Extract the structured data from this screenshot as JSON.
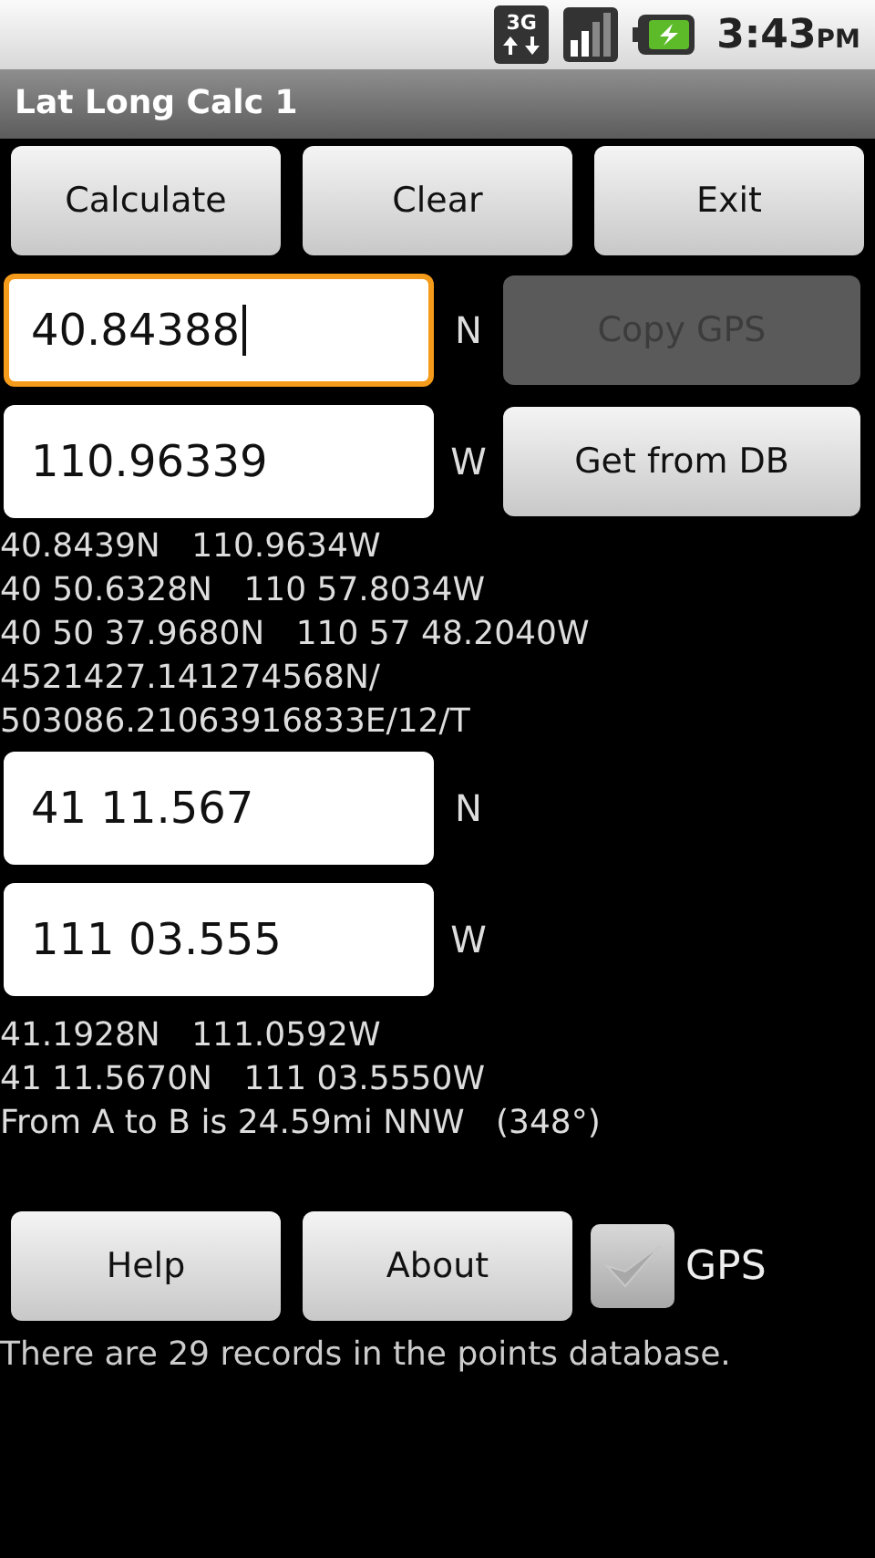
{
  "status_bar": {
    "network": "3G",
    "time": "3:43",
    "ampm": "PM"
  },
  "window": {
    "title": "Lat Long Calc 1"
  },
  "top_buttons": [
    "Calculate",
    "Clear",
    "Exit"
  ],
  "point_a": [
    {
      "value": "40.84388",
      "focused": true,
      "hemisphere": "N",
      "button": {
        "label": "Copy GPS",
        "disabled": true
      }
    },
    {
      "value": "110.96339",
      "focused": false,
      "hemisphere": "W",
      "button": {
        "label": "Get from DB",
        "disabled": false
      }
    }
  ],
  "results_a": [
    "40.8439N   110.9634W",
    "40 50.6328N   110 57.8034W",
    "40 50 37.9680N   110 57 48.2040W",
    "4521427.141274568N/",
    "503086.21063916833E/12/T"
  ],
  "point_b": [
    {
      "value": "41 11.567",
      "focused": false,
      "hemisphere": "N"
    },
    {
      "value": "111 03.555",
      "focused": false,
      "hemisphere": "W"
    }
  ],
  "results_b": [
    "41.1928N   111.0592W",
    "41 11.5670N   111 03.5550W",
    "From A to B is 24.59mi NNW   (348°)"
  ],
  "bottom_buttons": [
    "Help",
    "About"
  ],
  "gps_checkbox": {
    "label": "GPS",
    "checked": true,
    "disabled": true
  },
  "message": "There are 29 records in the points database."
}
